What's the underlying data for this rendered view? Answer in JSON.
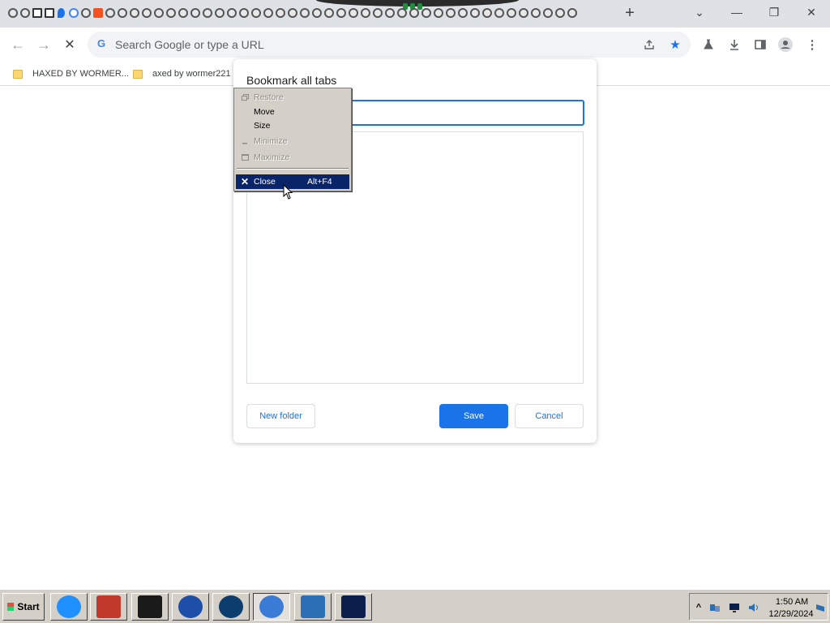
{
  "browser": {
    "tab_count_visible": 47,
    "newtab_label": "+",
    "window_controls": {
      "tabsearch": "⌄",
      "minimize": "—",
      "restore": "❐",
      "close": "✕"
    }
  },
  "toolbar": {
    "back": "←",
    "forward": "→",
    "stop": "✕",
    "omnibox_placeholder": "Search Google or type a URL",
    "google_g": "G"
  },
  "bookmarks_bar": {
    "items": [
      {
        "label": "HAXED BY WORMER..."
      },
      {
        "label": "axed by wormer221"
      }
    ]
  },
  "dialog": {
    "title": "Bookmark all tabs",
    "name_value": "",
    "buttons": {
      "new_folder": "New folder",
      "save": "Save",
      "cancel": "Cancel"
    }
  },
  "system_menu": {
    "items": [
      {
        "label": "Restore",
        "state": "disabled",
        "icon": "restore-icon",
        "accelerator": ""
      },
      {
        "label": "Move",
        "state": "normal",
        "icon": "",
        "accelerator": ""
      },
      {
        "label": "Size",
        "state": "normal",
        "icon": "",
        "accelerator": ""
      },
      {
        "label": "Minimize",
        "state": "disabled",
        "icon": "minimize-icon",
        "accelerator": ""
      },
      {
        "label": "Maximize",
        "state": "disabled",
        "icon": "maximize-icon",
        "accelerator": ""
      },
      {
        "label": "Close",
        "state": "selected",
        "icon": "close-icon",
        "accelerator": "Alt+F4"
      }
    ]
  },
  "taskbar": {
    "start_label": "Start",
    "apps": [
      {
        "name": "internet-explorer",
        "color": "#1e90ff"
      },
      {
        "name": "red-app",
        "color": "#c0392b"
      },
      {
        "name": "black-box-app",
        "color": "#1a1a1a"
      },
      {
        "name": "media-player",
        "color": "#1e4fa8"
      },
      {
        "name": "globe-app",
        "color": "#0b3d6e"
      },
      {
        "name": "chrome",
        "color": "#3a7bd5"
      },
      {
        "name": "powershell",
        "color": "#2c6fb5"
      },
      {
        "name": "terminal-app",
        "color": "#0c1f4a"
      }
    ],
    "tray": {
      "expand": "^",
      "time": "1:50 AM",
      "date": "12/29/2024"
    }
  },
  "colors": {
    "accent": "#1a73e8",
    "menu_selected": "#0a246a",
    "menu_bg": "#d4d0c8"
  }
}
